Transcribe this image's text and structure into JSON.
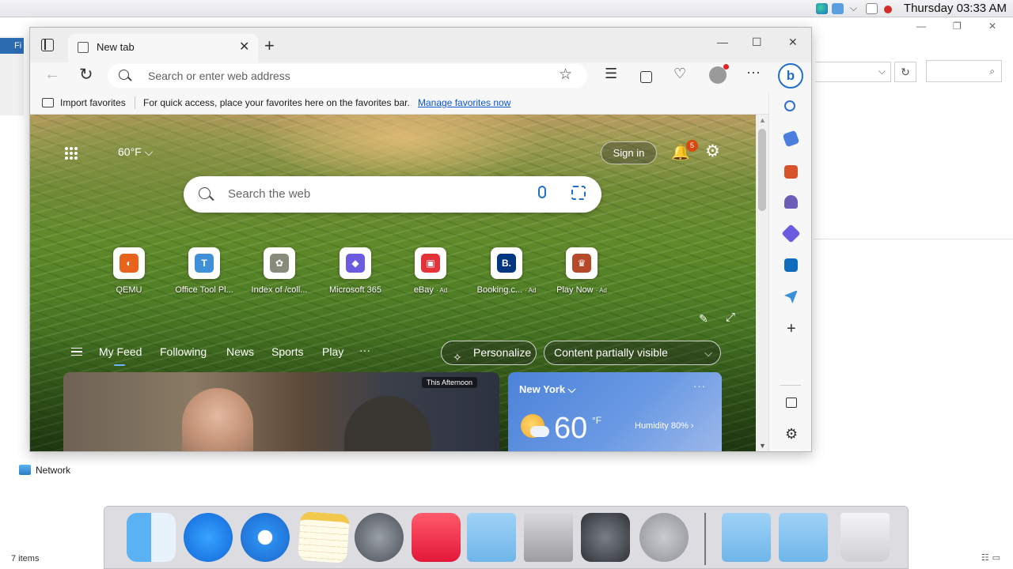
{
  "menubar": {
    "clock": "Thursday 03:33 AM",
    "apple_glyph": "",
    "tray_icons": [
      "edge-icon",
      "finder-icon",
      "chevron-icon",
      "display-icon",
      "network-off-icon"
    ]
  },
  "background_window": {
    "left_tab_label": "Fi",
    "network_label": "Network",
    "status_items": "7 items",
    "refresh_glyph": "↻",
    "search_glyph": "⌕",
    "minimize_glyph": "—",
    "restore_glyph": "❐",
    "close_glyph": "✕"
  },
  "browser": {
    "tab_title": "New tab",
    "tab_close": "✕",
    "new_tab": "+",
    "window_buttons": {
      "minimize": "—",
      "maximize": "☐",
      "close": "✕"
    },
    "nav": {
      "back": "←",
      "reload": "↻",
      "address_placeholder": "Search or enter web address",
      "star": "☆",
      "more": "···",
      "copilot": "b"
    },
    "nav_icons": [
      "favorites-icon",
      "collections-icon",
      "browser-essentials-icon"
    ],
    "favorites_bar": {
      "import_label": "Import favorites",
      "hint": "For quick access, place your favorites here on the favorites bar.",
      "manage_link": "Manage favorites now"
    },
    "ntp": {
      "weather_short": "60°F ⌵",
      "signin": "Sign in",
      "notification_count": "5",
      "bell_glyph": "🔔",
      "settings_glyph": "⚙",
      "search_placeholder": "Search the web",
      "tiles": [
        {
          "label": "QEMU",
          "ad": "",
          "glyph": "◐",
          "color": "#e8631c"
        },
        {
          "label": "Office Tool Pl...",
          "ad": "",
          "glyph": "T",
          "color": "#3f8fd9"
        },
        {
          "label": "Index of /coll...",
          "ad": "",
          "glyph": "✿",
          "color": "#8a8a7a"
        },
        {
          "label": "Microsoft 365",
          "ad": "",
          "glyph": "◆",
          "color": "#6a5be0"
        },
        {
          "label": "eBay",
          "ad": "· Ad",
          "glyph": "▣",
          "color": "#e53238"
        },
        {
          "label": "Booking.c...",
          "ad": "· Ad",
          "glyph": "B.",
          "color": "#003580"
        },
        {
          "label": "Play Now",
          "ad": "· Ad",
          "glyph": "♛",
          "color": "#b5492a"
        }
      ],
      "feed_tabs": [
        "My Feed",
        "Following",
        "News",
        "Sports",
        "Play",
        "···"
      ],
      "personalize": "Personalize",
      "personalize_glyph": "✧",
      "content_visibility": "Content partially visible",
      "content_chevron": "⌵",
      "news_tag": "This Afternoon",
      "edit_glyph": "✎",
      "expand_glyph": "⤢",
      "weather_card": {
        "city": "New York ⌵",
        "more": "···",
        "temp": "60",
        "unit": "°F",
        "humidity": "Humidity 80% ›"
      }
    },
    "sidebar_icons": [
      "search-icon",
      "shopping-tag-icon",
      "tools-icon",
      "games-icon",
      "microsoft365-icon",
      "outlook-icon",
      "send-icon"
    ],
    "sidebar_add": "+",
    "sidebar_settings": "⚙"
  },
  "dock": {
    "items": [
      "finder-icon",
      "app-store-icon",
      "safari-icon",
      "notes-icon",
      "launchpad-icon",
      "music-icon",
      "bank-folder-icon",
      "mac-pro-icon",
      "system-preferences-icon",
      "power-icon",
      "desktop-folder-icon",
      "documents-folder-icon",
      "trash-icon"
    ]
  }
}
